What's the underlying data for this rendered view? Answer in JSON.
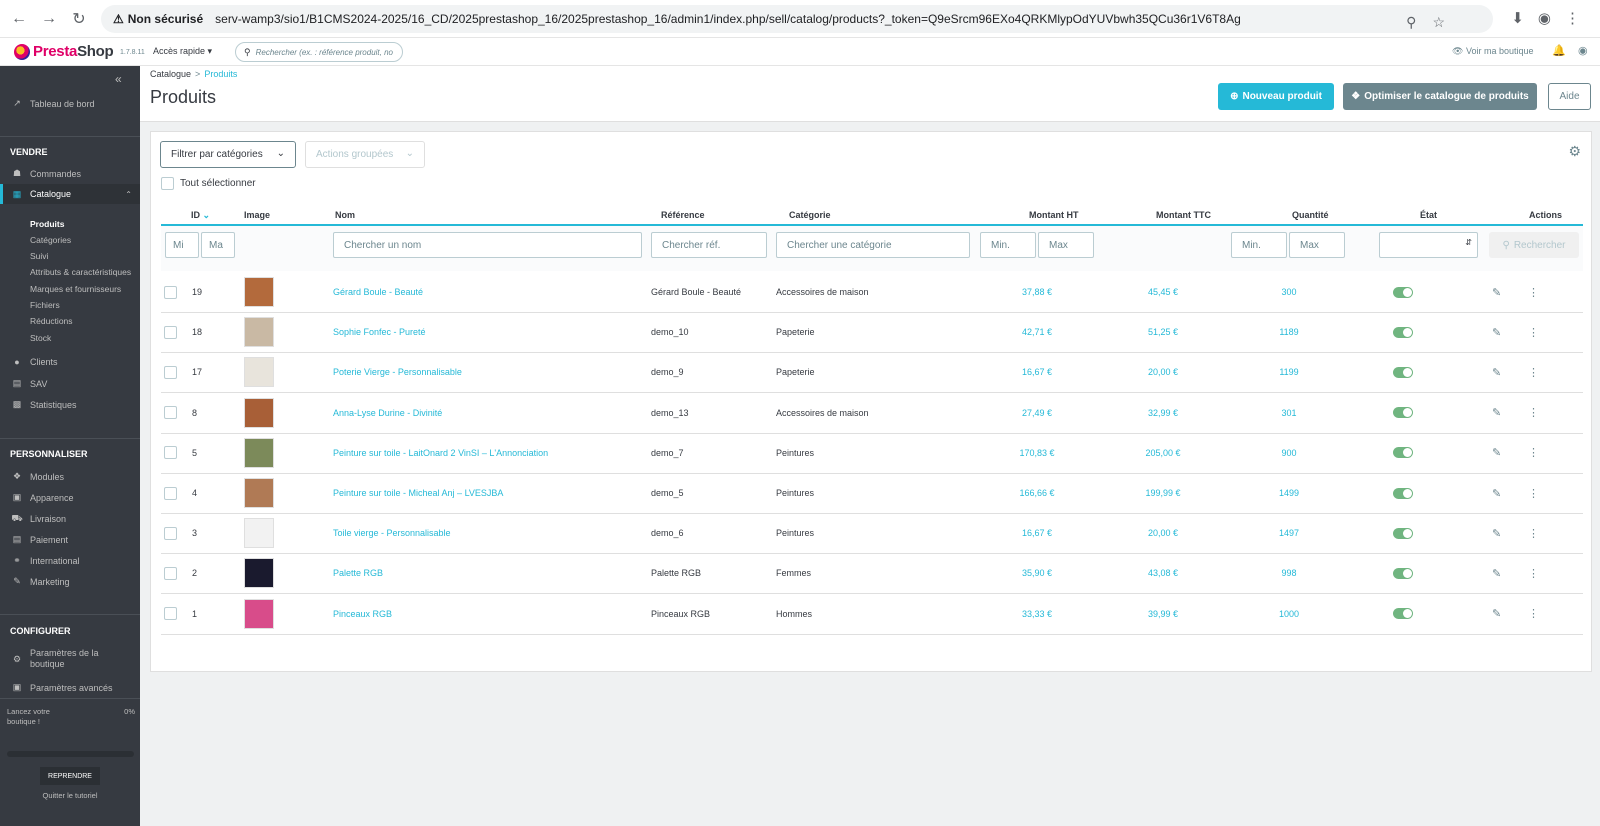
{
  "browser": {
    "insecure_label": "Non sécurisé",
    "url": "serv-wamp3/sio1/B1CMS2024-2025/16_CD/2025prestashop_16/2025prestashop_16/admin1/index.php/sell/catalog/products?_token=Q9eSrcm96EXo4QRKMlypOdYUVbwh35QCu36r1V6T8Ag"
  },
  "header": {
    "logo_prefix": "Presta",
    "logo_suffix": "Shop",
    "version": "1.7.8.11",
    "quick_access": "Accès rapide",
    "search_placeholder": "Rechercher (ex. : référence produit, no",
    "view_shop": "Voir ma boutique"
  },
  "sidebar": {
    "dashboard": "Tableau de bord",
    "sell_heading": "VENDRE",
    "orders": "Commandes",
    "catalog": "Catalogue",
    "catalog_sub": [
      "Produits",
      "Catégories",
      "Suivi",
      "Attributs & caractéristiques",
      "Marques et fournisseurs",
      "Fichiers",
      "Réductions",
      "Stock"
    ],
    "clients": "Clients",
    "sav": "SAV",
    "stats": "Statistiques",
    "customize_heading": "PERSONNALISER",
    "modules": "Modules",
    "appearance": "Apparence",
    "shipping": "Livraison",
    "payment": "Paiement",
    "international": "International",
    "marketing": "Marketing",
    "configure_heading": "CONFIGURER",
    "shop_params": "Paramètres de la boutique",
    "advanced_params": "Paramètres avancés",
    "onboarding_text": "Lancez votre boutique !",
    "onboarding_pct": "0%",
    "onboarding_progress": 0,
    "resume": "REPRENDRE",
    "quit": "Quitter le tutoriel"
  },
  "page": {
    "breadcrumb_parent": "Catalogue",
    "breadcrumb_current": "Produits",
    "title": "Produits",
    "btn_new": "Nouveau produit",
    "btn_optimize": "Optimiser le catalogue de produits",
    "btn_help": "Aide"
  },
  "toolbar": {
    "filter_categories": "Filtrer par catégories",
    "bulk_actions": "Actions groupées",
    "select_all": "Tout sélectionner"
  },
  "table": {
    "headers": {
      "id": "ID",
      "image": "Image",
      "name": "Nom",
      "reference": "Référence",
      "category": "Catégorie",
      "price_ht": "Montant HT",
      "price_ttc": "Montant TTC",
      "quantity": "Quantité",
      "state": "État",
      "actions": "Actions"
    },
    "filters": {
      "id_min": "Mi",
      "id_max": "Ma",
      "name": "Chercher un nom",
      "ref": "Chercher réf.",
      "category": "Chercher une catégorie",
      "price_min": "Min.",
      "price_max": "Max",
      "qty_min": "Min.",
      "qty_max": "Max",
      "search_button": "Rechercher"
    },
    "rows": [
      {
        "id": "19",
        "name": "Gérard Boule - Beauté",
        "ref": "Gérard Boule - Beauté",
        "category": "Accessoires de maison",
        "ht": "37,88 €",
        "ttc": "45,45 €",
        "qty": "300",
        "thumb": "#b36a3c"
      },
      {
        "id": "18",
        "name": "Sophie Fonfec - Pureté",
        "ref": "demo_10",
        "category": "Papeterie",
        "ht": "42,71 €",
        "ttc": "51,25 €",
        "qty": "1189",
        "thumb": "#c9b9a4"
      },
      {
        "id": "17",
        "name": "Poterie Vierge - Personnalisable",
        "ref": "demo_9",
        "category": "Papeterie",
        "ht": "16,67 €",
        "ttc": "20,00 €",
        "qty": "1199",
        "thumb": "#e8e4dc"
      },
      {
        "id": "8",
        "name": "Anna-Lyse Durine - Divinité",
        "ref": "demo_13",
        "category": "Accessoires de maison",
        "ht": "27,49 €",
        "ttc": "32,99 €",
        "qty": "301",
        "thumb": "#a85f37"
      },
      {
        "id": "5",
        "name": "Peinture sur toile - LaitOnard 2 VinSI – L'Annonciation",
        "ref": "demo_7",
        "category": "Peintures",
        "ht": "170,83 €",
        "ttc": "205,00 €",
        "qty": "900",
        "thumb": "#7c8a5a"
      },
      {
        "id": "4",
        "name": "Peinture sur toile - Micheal Anj – LVESJBA",
        "ref": "demo_5",
        "category": "Peintures",
        "ht": "166,66 €",
        "ttc": "199,99 €",
        "qty": "1499",
        "thumb": "#b07a55"
      },
      {
        "id": "3",
        "name": "Toile vierge - Personnalisable",
        "ref": "demo_6",
        "category": "Peintures",
        "ht": "16,67 €",
        "ttc": "20,00 €",
        "qty": "1497",
        "thumb": "#f2f2f2"
      },
      {
        "id": "2",
        "name": "Palette RGB",
        "ref": "Palette RGB",
        "category": "Femmes",
        "ht": "35,90 €",
        "ttc": "43,08 €",
        "qty": "998",
        "thumb": "#1a1a2e"
      },
      {
        "id": "1",
        "name": "Pinceaux RGB",
        "ref": "Pinceaux RGB",
        "category": "Hommes",
        "ht": "33,33 €",
        "ttc": "39,99 €",
        "qty": "1000",
        "thumb": "#d84c8a"
      }
    ]
  }
}
